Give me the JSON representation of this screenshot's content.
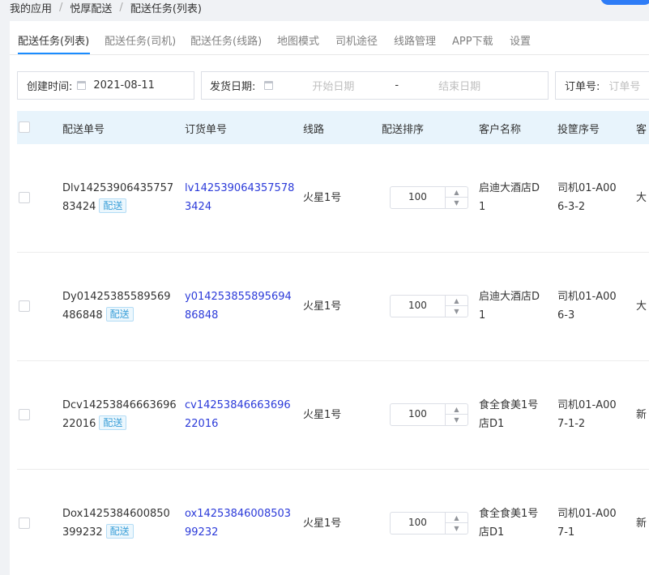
{
  "breadcrumb": [
    "我的应用",
    "悦厚配送",
    "配送任务(列表)"
  ],
  "tabs": [
    "配送任务(列表)",
    "配送任务(司机)",
    "配送任务(线路)",
    "地图模式",
    "司机途径",
    "线路管理",
    "APP下载",
    "设置"
  ],
  "filters": {
    "created_label": "创建时间:",
    "created_value": "2021-08-11",
    "ship_label": "发货日期:",
    "start_placeholder": "开始日期",
    "range_sep": "-",
    "end_placeholder": "结束日期",
    "order_label": "订单号:",
    "order_placeholder": "订单号"
  },
  "columns": [
    "配送单号",
    "订货单号",
    "线路",
    "配送排序",
    "客户名称",
    "投筐序号",
    "客"
  ],
  "rows": [
    {
      "delivery_l1": "Dlv14253906435757",
      "delivery_l2": "83424",
      "tag": "配送",
      "order_l1": "lv142539064357578",
      "order_l2": "3424",
      "route": "火星1号",
      "sort": "100",
      "customer_l1": "启迪大酒店D",
      "customer_l2": "1",
      "basket_l1": "司机01-A00",
      "basket_l2": "6-3-2",
      "trunc": "大"
    },
    {
      "delivery_l1": "Dy01425385589569",
      "delivery_l2": "486848",
      "tag": "配送",
      "order_l1": "y014253855895694",
      "order_l2": "86848",
      "route": "火星1号",
      "sort": "100",
      "customer_l1": "启迪大酒店D",
      "customer_l2": "1",
      "basket_l1": "司机01-A00",
      "basket_l2": "6-3",
      "trunc": "大"
    },
    {
      "delivery_l1": "Dcv14253846663696",
      "delivery_l2": "22016",
      "tag": "配送",
      "order_l1": "cv14253846663696",
      "order_l2": "22016",
      "route": "火星1号",
      "sort": "100",
      "customer_l1": "食全食美1号",
      "customer_l2": "店D1",
      "basket_l1": "司机01-A00",
      "basket_l2": "7-1-2",
      "trunc": "新"
    },
    {
      "delivery_l1": "Dox1425384600850",
      "delivery_l2": "399232",
      "tag": "配送",
      "order_l1": "ox14253846008503",
      "order_l2": "99232",
      "route": "火星1号",
      "sort": "100",
      "customer_l1": "食全食美1号",
      "customer_l2": "店D1",
      "basket_l1": "司机01-A00",
      "basket_l2": "7-1",
      "trunc": "新"
    }
  ],
  "colors": {
    "accent": "#1a8cff",
    "link": "#2b3ad9",
    "header_bg": "#e8f4fc",
    "tag_text": "#3a9fd8"
  },
  "icons": {
    "calendar": "calendar-icon",
    "stepper_up": "chevron-up-icon",
    "stepper_down": "chevron-down-icon"
  }
}
